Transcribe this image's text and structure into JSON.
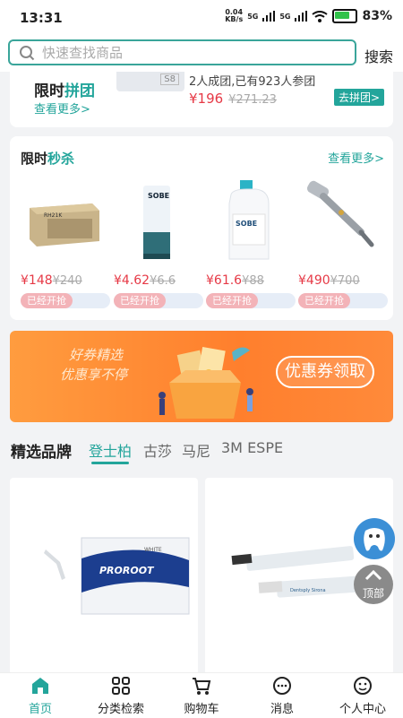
{
  "status": {
    "time": "13:31",
    "net_speed_value": "0.04",
    "net_speed_unit": "KB/s",
    "net1": "5G",
    "net2": "5G",
    "battery": "83%"
  },
  "search": {
    "placeholder": "快速查找商品",
    "button": "搜索"
  },
  "group_buy": {
    "title_a": "限时",
    "title_b": "拼团",
    "more": "查看更多>",
    "thumb_label": "S8",
    "info": "2人成团,已有923人参团",
    "price": "¥196",
    "old_price": "¥271.23",
    "button": "去拼团>"
  },
  "flash_sale": {
    "title_a": "限时",
    "title_b": "秒杀",
    "more": "查看更多>",
    "products": [
      {
        "price": "¥148",
        "old_price": "¥240",
        "status": "已经开抢",
        "box_label": "RH21K"
      },
      {
        "price": "¥4.62",
        "old_price": "¥6.6",
        "status": "已经开抢",
        "brand": "SOBE"
      },
      {
        "price": "¥61.6",
        "old_price": "¥88",
        "status": "已经开抢",
        "brand": "SOBE"
      },
      {
        "price": "¥490",
        "old_price": "¥700",
        "status": "已经开抢"
      }
    ]
  },
  "banner": {
    "line1": "好券精选",
    "line2": "优惠享不停",
    "button": "优惠券领取"
  },
  "brands": {
    "label": "精选品牌",
    "tabs": [
      "登士柏",
      "古莎",
      "马尼",
      "3M ESPE"
    ],
    "active_index": 0
  },
  "goods": [
    {
      "box_text": "PROROOT",
      "box_sub": "WHITE"
    },
    {
      "tube_text": "Dentsply Sirona"
    }
  ],
  "float": {
    "top_label": "顶部"
  },
  "tabbar": {
    "items": [
      "首页",
      "分类检索",
      "购物车",
      "消息",
      "个人中心"
    ],
    "active_index": 0
  },
  "colors": {
    "accent": "#23a59b",
    "price": "#e63946",
    "banner": "#ff8a3a"
  }
}
